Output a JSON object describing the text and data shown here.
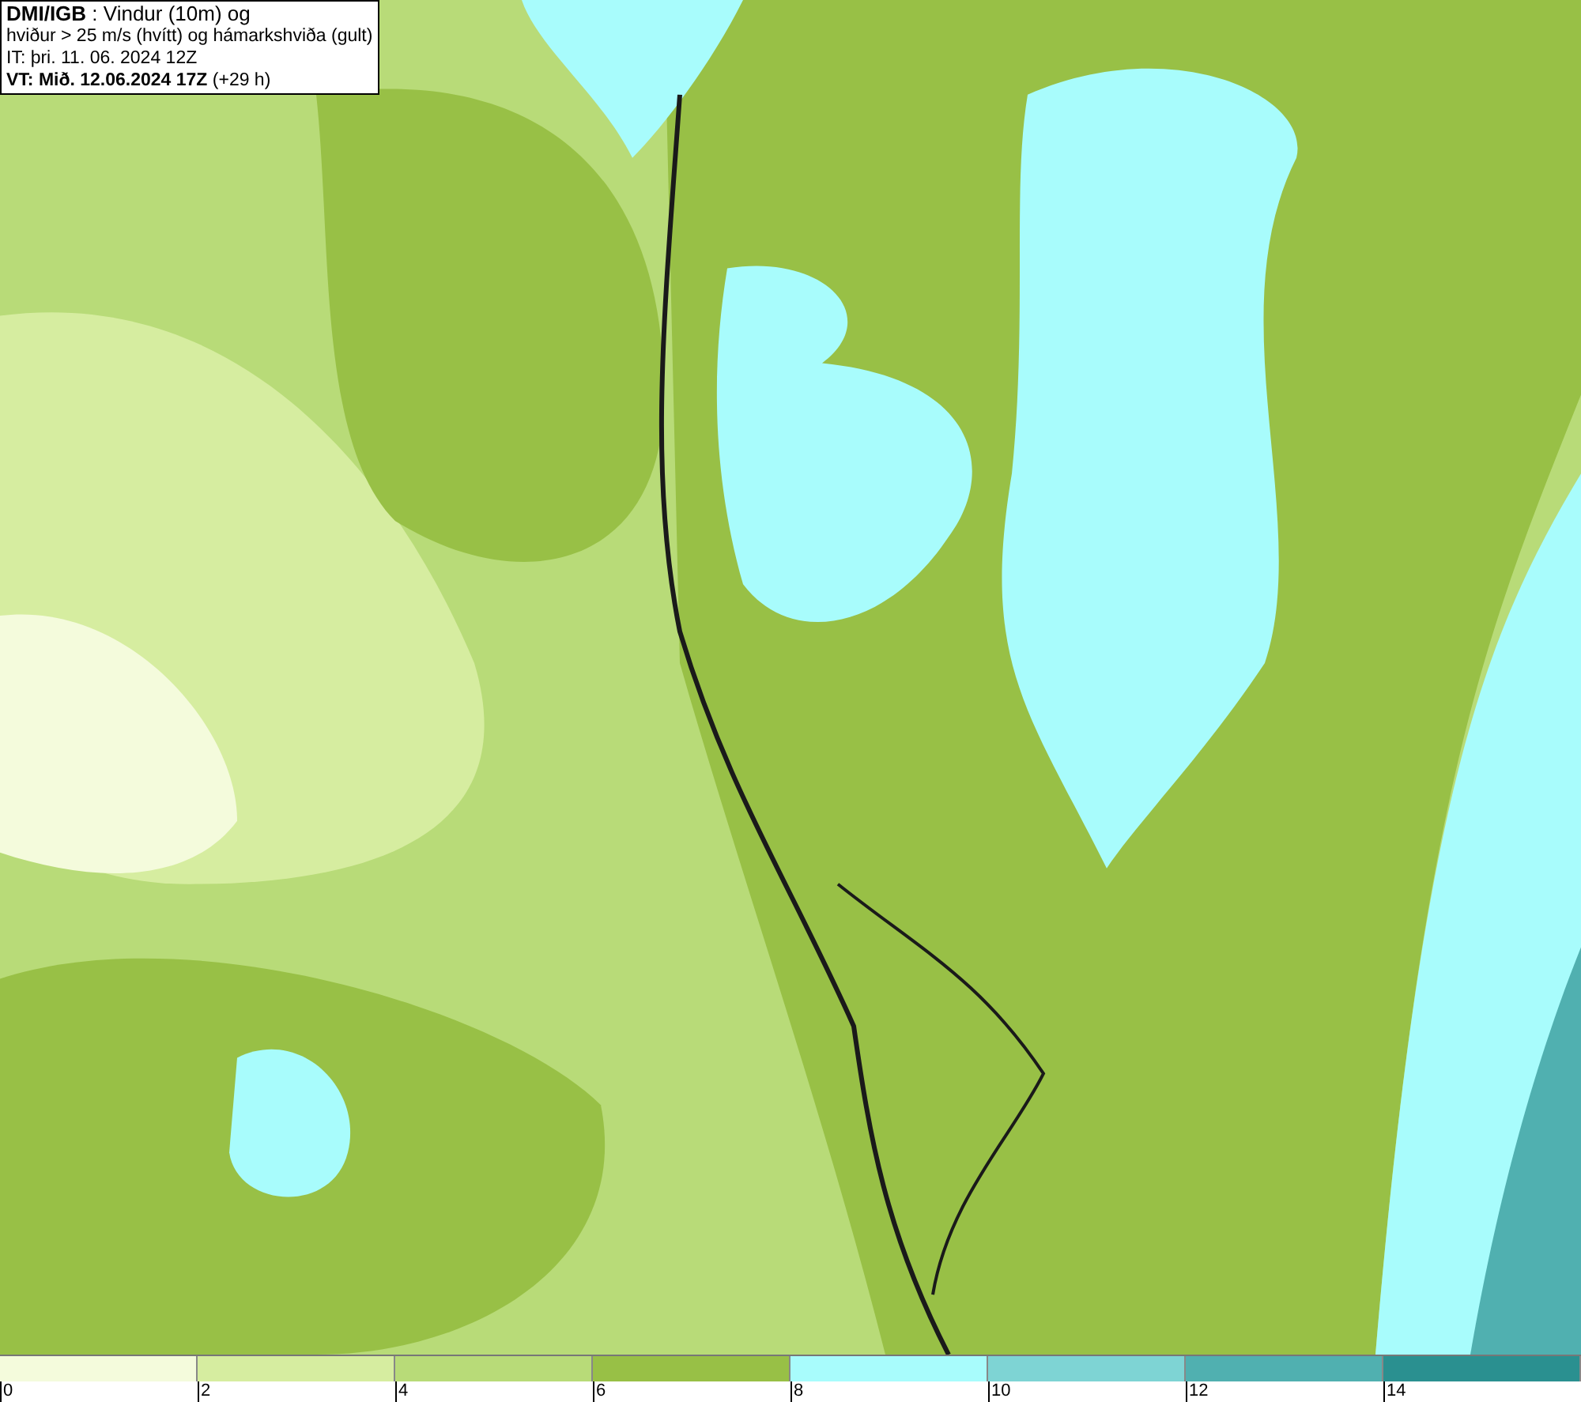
{
  "title_box": {
    "lines": [
      "**DMI/IGB** : Vindur (10m) og",
      "hviður > 25 m/s (hvítt) og hámarkshviða (gult)",
      "IT: þri. 11. 06. 2024 12Z",
      "**VT: Mið. 12.06.2024 17Z** (+29 h)"
    ]
  },
  "legend": {
    "bins": [
      {
        "color": "#f4fbdc"
      },
      {
        "color": "#d6eda0"
      },
      {
        "color": "#b8db78"
      },
      {
        "color": "#98c046"
      },
      {
        "color": "#a8fcfc"
      },
      {
        "color": "#7ed4d4"
      },
      {
        "color": "#50b0b0"
      },
      {
        "color": "#2a9090"
      }
    ],
    "ticks": [
      "0",
      "2",
      "4",
      "6",
      "8",
      "10",
      "12",
      "14"
    ]
  }
}
